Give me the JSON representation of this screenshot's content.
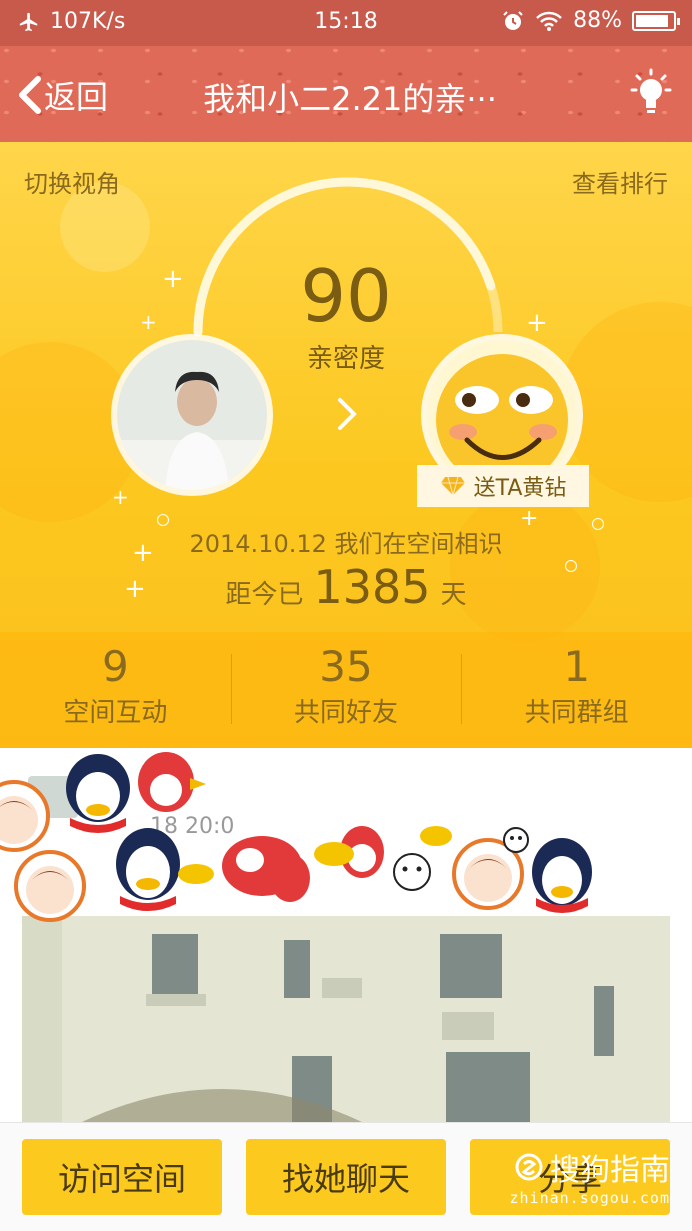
{
  "status_bar": {
    "network_speed": "107K/s",
    "time": "15:18",
    "battery": "88%",
    "battery_level": 0.88,
    "icons": [
      "airplane-icon",
      "alarm-icon",
      "wifi-icon",
      "battery-icon"
    ]
  },
  "nav": {
    "back_label": "返回",
    "title": "我和小二2.21的亲···",
    "icons": [
      "chevron-left-icon",
      "lightbulb-icon"
    ]
  },
  "hero": {
    "switch_view": "切换视角",
    "view_ranking": "查看排行",
    "score": "90",
    "score_label": "亲密度",
    "arc_progress": 0.9,
    "gift_label": "送TA黄钻",
    "since_text": "2014.10.12 我们在空间相识",
    "days_prefix": "距今已",
    "days_value": "1385",
    "days_suffix": "天"
  },
  "stats": [
    {
      "value": "9",
      "label": "空间互动"
    },
    {
      "value": "35",
      "label": "共同好友"
    },
    {
      "value": "1",
      "label": "共同群组"
    }
  ],
  "feed": {
    "time_fragment": "18 20:0"
  },
  "bottom": {
    "visit_button": "访问空间",
    "chat_button": "找她聊天",
    "share_button": "分享",
    "watermark_line1": "搜狗指南",
    "watermark_line2": "zhinan.sogou.com"
  },
  "colors": {
    "status_bar": "#c85a4c",
    "nav_bar": "#e06a58",
    "hero_yellow": "#fcc81f",
    "button_yellow": "#fcc91f",
    "text_brown": "#7a5c12"
  }
}
